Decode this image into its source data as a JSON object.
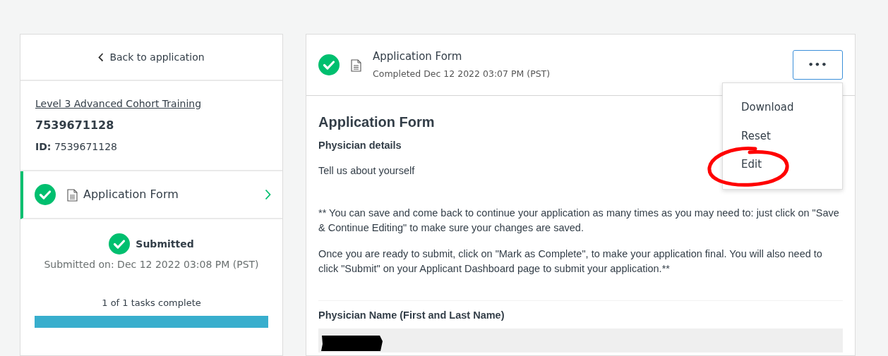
{
  "sidebar": {
    "back_link": "Back to application",
    "program_link": "Level 3 Advanced Cohort Training",
    "applicant_name": "7539671128",
    "id_label": "ID:",
    "id_value": "7539671128",
    "tasks": [
      {
        "label": "Application Form",
        "completed": true,
        "selected": true
      }
    ],
    "status": {
      "label": "Submitted",
      "completed": true,
      "submitted_on": "Submitted on: Dec 12 2022 03:08 PM (PST)"
    },
    "progress": {
      "label": "1 of 1 tasks complete",
      "level": 1.0
    }
  },
  "form_header": {
    "title": "Application Form",
    "completed": true,
    "subtitle": "Completed Dec 12 2022 03:07 PM (PST)",
    "more_button": {
      "label": "•••",
      "expanded": true
    },
    "menu_items": [
      {
        "label": "Download",
        "circled": false
      },
      {
        "label": "Reset",
        "circled": false
      },
      {
        "label": "Edit",
        "circled": true
      }
    ]
  },
  "form": {
    "title": "Application Form",
    "section": "Physician details",
    "intro": "Tell us about yourself",
    "paragraphs": [
      "** You can save and come back to continue your application as many times as you may need to: just click on \"Save & Continue Editing\" to make sure your changes are saved.",
      "Once you are ready to submit, click on \"Mark as Complete\", to make your application final. You will also need to click \"Submit\" on your Applicant Dashboard page to submit your application.**"
    ],
    "fields": [
      {
        "label": "Physician Name (First and Last Name)",
        "redacted": true
      }
    ]
  }
}
